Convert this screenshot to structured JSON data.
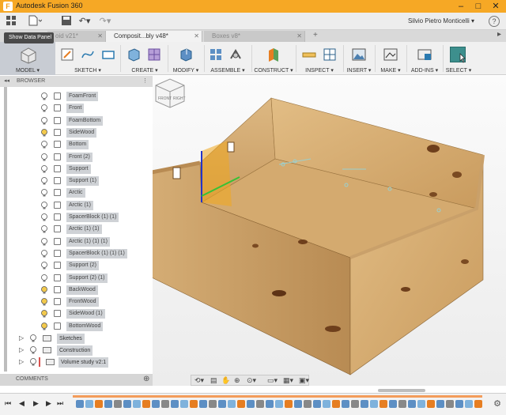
{
  "window": {
    "title": "Autodesk Fusion 360",
    "app_icon": "F"
  },
  "quick_access": {
    "user": "Silvio Pietro Monticelli ▾"
  },
  "tabs": [
    {
      "label": "oid v21*"
    },
    {
      "label": "Composit...bly v48*"
    },
    {
      "label": "Boxes v8*"
    }
  ],
  "tooltip": "Show Data Panel",
  "toolbar": {
    "model_label": "MODEL ▾",
    "sketch_label": "SKETCH ▾",
    "create_label": "CREATE ▾",
    "modify_label": "MODIFY ▾",
    "assemble_label": "ASSEMBLE ▾",
    "construct_label": "CONSTRUCT ▾",
    "inspect_label": "INSPECT ▾",
    "insert_label": "INSERT ▾",
    "make_label": "MAKE ▾",
    "addins_label": "ADD-INS ▾",
    "select_label": "SELECT ▾"
  },
  "browser": {
    "title": "BROWSER",
    "bodies": [
      "FoamFront",
      "Front",
      "FoamBottom",
      "SideWood",
      "Bottom",
      "Front (2)",
      "Support",
      "Support (1)",
      "Arctic",
      "Arctic (1)",
      "SpacerBlock (1) (1)",
      "Arctic (1) (1)",
      "Arctic (1) (1) (1)",
      "SpacerBlock (1) (1) (1)",
      "Support (2)",
      "Support (2) (1)",
      "BackWood",
      "FrontWood",
      "SideWood (1)",
      "BottomWood"
    ],
    "folders": [
      "Sketches",
      "Construction",
      "Volume study v2:1"
    ]
  },
  "comments": {
    "label": "COMMENTS"
  },
  "viewcube": {
    "front": "FRONT",
    "right": "RIGHT"
  },
  "colors": {
    "titlebar": "#f6a825",
    "wood": "#d7b077",
    "select_accent": "#3d8f8d",
    "timeline_track": "#f39c5a"
  }
}
